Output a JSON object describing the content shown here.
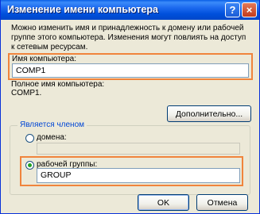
{
  "window": {
    "title": "Изменение имени компьютера"
  },
  "titlebar": {
    "help_glyph": "?",
    "close_glyph": "×"
  },
  "description": "Можно изменить имя и принадлежность к домену или рабочей группе этого компьютера. Изменения могут повлиять на доступ к сетевым ресурсам.",
  "computer_name": {
    "label": "Имя компьютера:",
    "value": "COMP1"
  },
  "full_name": {
    "label": "Полное имя компьютера:",
    "value": "COMP1."
  },
  "more_button": "Дополнительно...",
  "membership": {
    "legend": "Является членом",
    "domain": {
      "label": "домена:",
      "value": "",
      "selected": false
    },
    "workgroup": {
      "label": "рабочей группы:",
      "value": "GROUP",
      "selected": true
    }
  },
  "buttons": {
    "ok": "OK",
    "cancel": "Отмена"
  },
  "colors": {
    "title_blue": "#0A5FE6",
    "highlight_orange": "#F0843C",
    "dialog_bg": "#ECE9D8"
  }
}
